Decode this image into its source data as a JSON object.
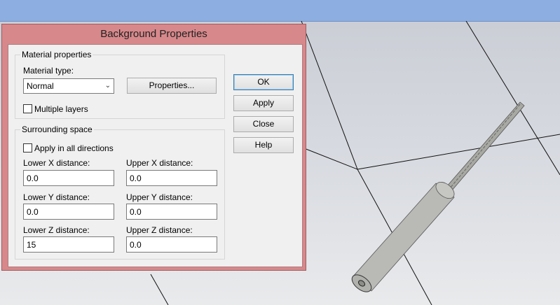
{
  "dialog": {
    "title": "Background Properties",
    "material_group": {
      "title": "Material properties",
      "type_label": "Material type:",
      "type_value": "Normal",
      "properties_button": "Properties...",
      "multiple_layers_label": "Multiple layers",
      "multiple_layers_checked": false
    },
    "surrounding_group": {
      "title": "Surrounding space",
      "apply_all_label": "Apply in all directions",
      "apply_all_checked": false,
      "lower_x_label": "Lower X distance:",
      "lower_x_value": "0.0",
      "upper_x_label": "Upper X distance:",
      "upper_x_value": "0.0",
      "lower_y_label": "Lower Y distance:",
      "lower_y_value": "0.0",
      "upper_y_label": "Upper Y distance:",
      "upper_y_value": "0.0",
      "lower_z_label": "Lower Z distance:",
      "lower_z_value": "15",
      "upper_z_label": "Upper Z distance:",
      "upper_z_value": "0.0"
    },
    "buttons": {
      "ok": "OK",
      "apply": "Apply",
      "close": "Close",
      "help": "Help"
    }
  },
  "colors": {
    "title_bar": "#d7888b",
    "top_bar": "#8daee0",
    "viewport_bg": "#d7dae0",
    "model": "#b9bab5"
  }
}
